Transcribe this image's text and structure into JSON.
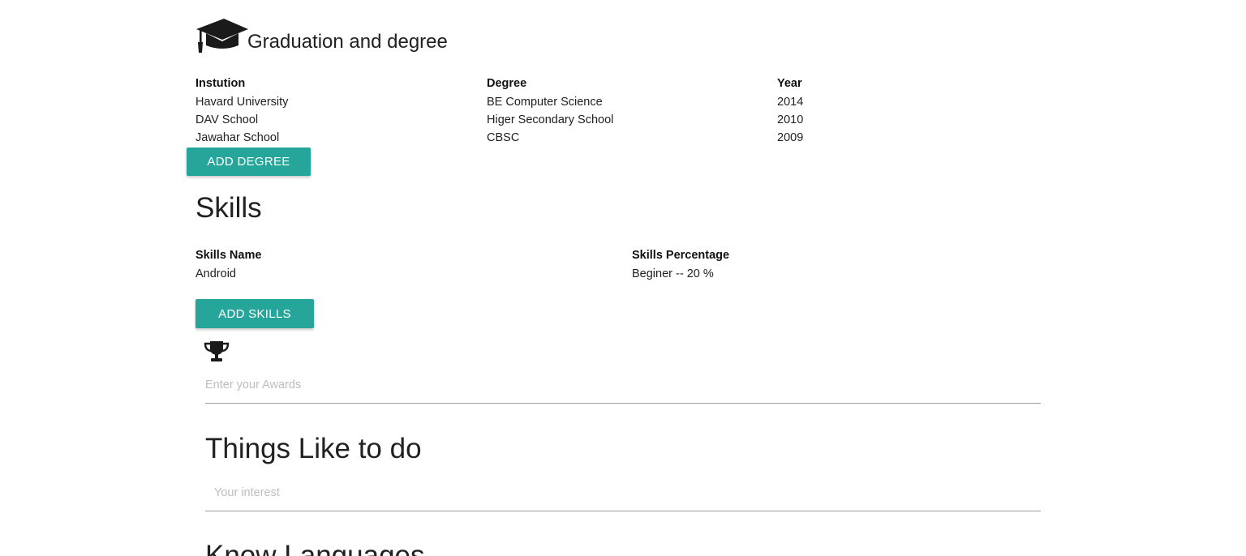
{
  "education": {
    "icon": "graduation-cap-icon",
    "title": "Graduation and degree",
    "columns": [
      "Instution",
      "Degree",
      "Year"
    ],
    "rows": [
      [
        "Havard University",
        "BE Computer Science",
        "2014"
      ],
      [
        "DAV School",
        "Higer Secondary School",
        "2010"
      ],
      [
        "Jawahar School",
        "CBSC",
        "2009"
      ]
    ],
    "add_button": "ADD DEGREE"
  },
  "skills": {
    "title": "Skills",
    "columns": [
      "Skills Name",
      "Skills Percentage"
    ],
    "rows": [
      [
        "Android",
        "Beginer -- 20 %"
      ]
    ],
    "add_button": "ADD SKILLS"
  },
  "awards": {
    "icon": "trophy-icon",
    "placeholder": "Enter your Awards"
  },
  "interests": {
    "title": "Things Like to do",
    "placeholder": "Your interest"
  },
  "languages": {
    "title": "Know Languages"
  },
  "colors": {
    "accent": "#26a69a",
    "text": "#212121",
    "placeholder": "#bdbdbd",
    "underline": "#9e9e9e"
  }
}
